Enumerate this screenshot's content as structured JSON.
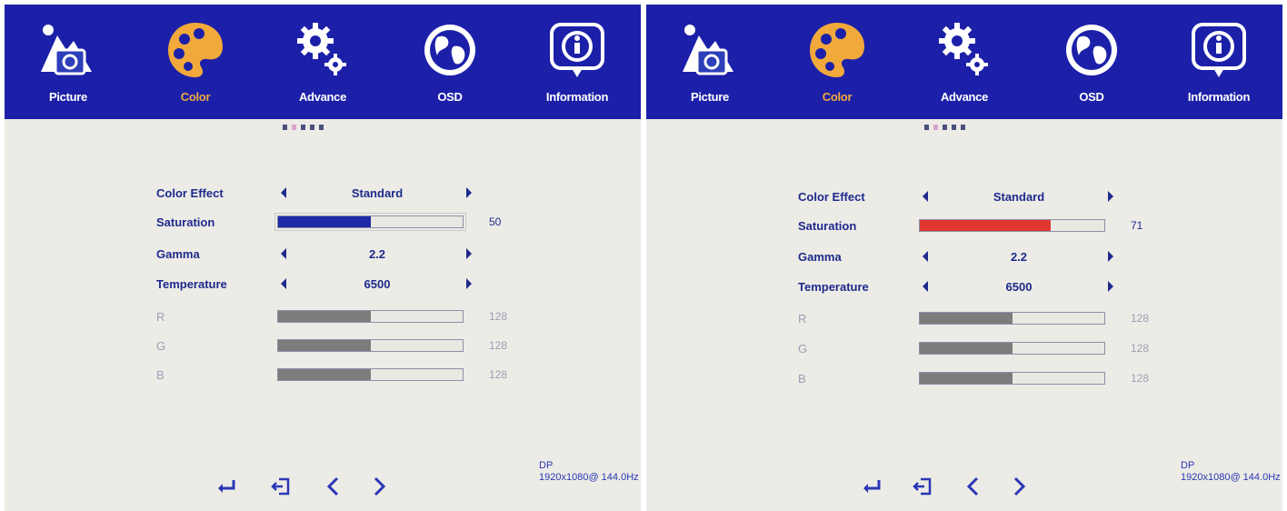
{
  "screens": [
    {
      "tabs": [
        {
          "label": "Picture",
          "icon": "picture-icon"
        },
        {
          "label": "Color",
          "icon": "palette-icon"
        },
        {
          "label": "Advance",
          "icon": "gears-icon"
        },
        {
          "label": "OSD",
          "icon": "globe-icon"
        },
        {
          "label": "Information",
          "icon": "info-icon"
        }
      ],
      "rows": {
        "color_effect": {
          "label": "Color Effect",
          "value": "Standard"
        },
        "saturation": {
          "label": "Saturation",
          "value": "50",
          "level": 0.5,
          "color": "#1c2aa8"
        },
        "gamma": {
          "label": "Gamma",
          "value": "2.2"
        },
        "temperature": {
          "label": "Temperature",
          "value": "6500"
        },
        "r": {
          "label": "R",
          "value": "128",
          "level": 0.5,
          "color": "#7c7c7c"
        },
        "g": {
          "label": "G",
          "value": "128",
          "level": 0.5,
          "color": "#7c7c7c"
        },
        "b": {
          "label": "B",
          "value": "128",
          "level": 0.5,
          "color": "#7c7c7c"
        }
      },
      "source": {
        "input": "DP",
        "resolution": "1920x1080@ 144.0Hz"
      }
    },
    {
      "tabs": [
        {
          "label": "Picture",
          "icon": "picture-icon"
        },
        {
          "label": "Color",
          "icon": "palette-icon"
        },
        {
          "label": "Advance",
          "icon": "gears-icon"
        },
        {
          "label": "OSD",
          "icon": "globe-icon"
        },
        {
          "label": "Information",
          "icon": "info-icon"
        }
      ],
      "rows": {
        "color_effect": {
          "label": "Color Effect",
          "value": "Standard"
        },
        "saturation": {
          "label": "Saturation",
          "value": "71",
          "level": 0.71,
          "color": "#e0372e"
        },
        "gamma": {
          "label": "Gamma",
          "value": "2.2"
        },
        "temperature": {
          "label": "Temperature",
          "value": "6500"
        },
        "r": {
          "label": "R",
          "value": "128",
          "level": 0.5,
          "color": "#7c7c7c"
        },
        "g": {
          "label": "G",
          "value": "128",
          "level": 0.5,
          "color": "#7c7c7c"
        },
        "b": {
          "label": "B",
          "value": "128",
          "level": 0.5,
          "color": "#7c7c7c"
        }
      },
      "source": {
        "input": "DP",
        "resolution": "1920x1080@ 144.0Hz"
      }
    }
  ],
  "colors": {
    "menu_bar": "#1c20a8",
    "active_tab": "#f2a93b",
    "text": "#1e2a8c",
    "background": "#ecebe6"
  }
}
